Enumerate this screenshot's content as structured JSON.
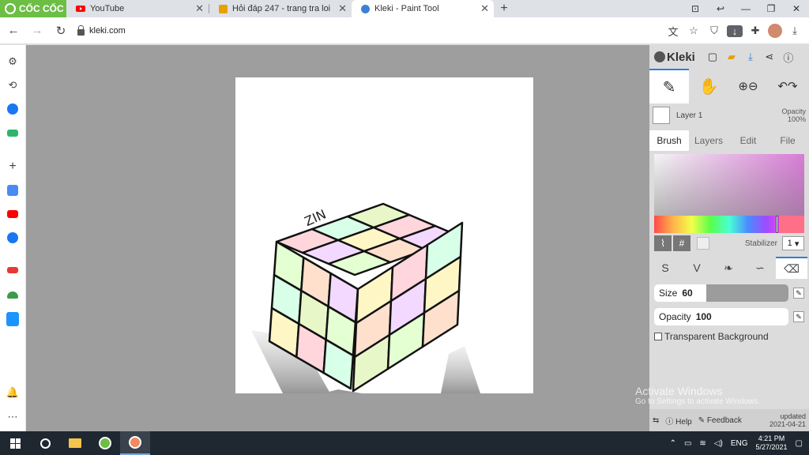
{
  "browser": {
    "brand_label": "CỐC CỐC",
    "tabs": [
      {
        "title": "YouTube",
        "icon": "youtube-icon"
      },
      {
        "title": "Hỏi đáp 247 - trang tra loi",
        "icon": "hoidap-icon"
      },
      {
        "title": "Kleki - Paint Tool",
        "icon": "kleki-icon",
        "active": true
      }
    ],
    "tab_close_glyph": "✕",
    "new_tab_glyph": "+",
    "url": "kleki.com"
  },
  "app": {
    "name": "Kleki",
    "layer": {
      "name": "Layer 1",
      "opacity_label": "Opacity",
      "opacity_value": "100%"
    },
    "tabs": [
      "Brush",
      "Layers",
      "Edit",
      "File"
    ],
    "active_tab": "Brush",
    "color_hash": "#",
    "stabilizer_label": "Stabilizer",
    "stabilizer_value": "1",
    "size_label": "Size",
    "size_value": "60",
    "opacity_label": "Opacity",
    "opacity_value": "100",
    "transparent_bg_label": "Transparent Background",
    "help_label": "Help",
    "feedback_label": "Feedback",
    "updated_label": "updated",
    "updated_date": "2021-04-21",
    "brush_color": "#ff6f88"
  },
  "canvas": {
    "drawing_text": "ZIN"
  },
  "watermark": {
    "line1": "Activate Windows",
    "line2": "Go to Settings to activate Windows."
  },
  "taskbar": {
    "language": "ENG",
    "time": "4:21 PM",
    "date": "5/27/2021"
  }
}
